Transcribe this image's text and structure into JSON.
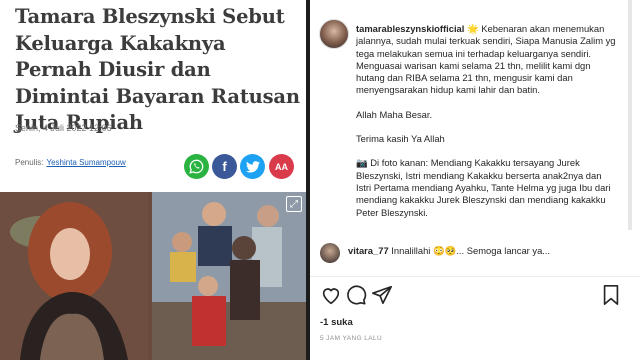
{
  "article": {
    "headline": "Tamara Bleszynski Sebut Keluarga Kakaknya Pernah Diusir dan Dimintai Bayaran Ratusan Juta Rupiah",
    "date": "Senin, 4 Juli 2022 12:06",
    "byline_label": "Penulis:",
    "author": "Yeshinta Sumampouw",
    "share_buttons": [
      {
        "icon": "whatsapp-icon",
        "glyph": "✆",
        "color": "#2bb342"
      },
      {
        "icon": "facebook-icon",
        "glyph": "f",
        "color": "#3b5998"
      },
      {
        "icon": "twitter-icon",
        "glyph": "✦",
        "color": "#1da1f2"
      },
      {
        "icon": "font-size-icon",
        "glyph": "AA",
        "color": "#d93b4b"
      }
    ],
    "expand_icon": "expand-icon"
  },
  "instagram": {
    "username": "tamarableszynskiofficial",
    "caption": [
      "🌟 Kebenaran akan menemukan jalannya, sudah mulai terkuak sendiri, Siapa Manusia Zalim yg tega melakukan semua ini terhadap keluarganya sendiri. Menguasai warisan kami selama 21 thn, melilit kami dgn hutang dan RIBA selama 21 thn, mengusir kami dan menyengsarakan hidup kami lahir dan batin.",
      "Allah Maha Besar.",
      "Terima kasih Ya Allah",
      "📷 Di foto kanan: Mendiang Kakakku tersayang Jurek Bleszynski, Istri mendiang Kakakku berserta anak2nya dan Istri Pertama mendiang Ayahku, Tante Helma yg juga Ibu dari mendiang kakakku Jurek Bleszynski dan mendiang kakakku Peter Bleszynski."
    ],
    "comment": {
      "user": "vitara_77",
      "text": "Innalillahi 😳🥺... Semoga lancar ya..."
    },
    "actions": [
      "heart-icon",
      "comment-icon",
      "share-icon",
      "bookmark-icon"
    ],
    "likes": "-1 suka",
    "time_ago": "5 JAM YANG LALU"
  }
}
